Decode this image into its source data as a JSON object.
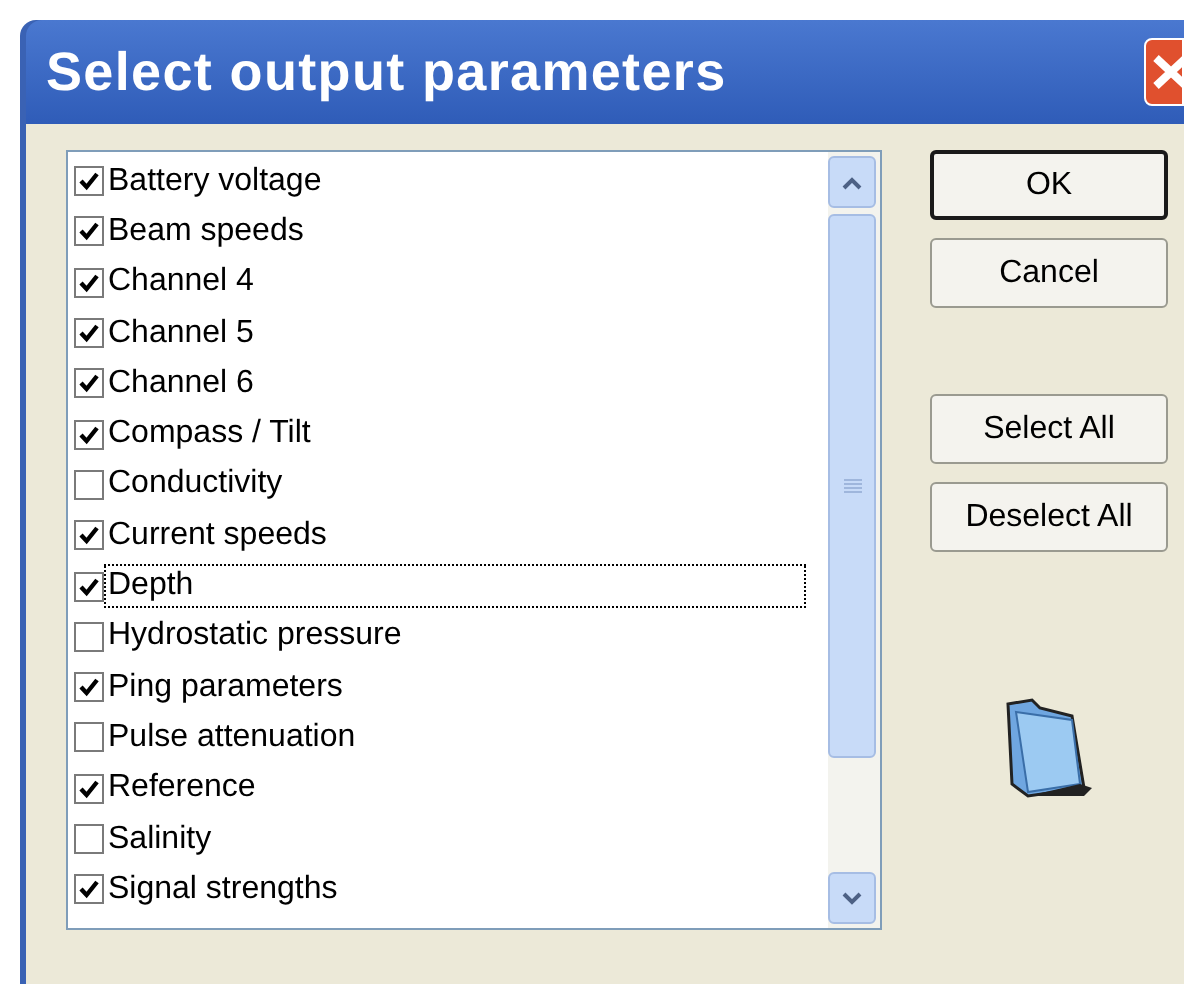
{
  "window": {
    "title": "Select output parameters"
  },
  "parameters": [
    {
      "label": "Battery voltage",
      "checked": true,
      "focused": false
    },
    {
      "label": "Beam speeds",
      "checked": true,
      "focused": false
    },
    {
      "label": "Channel 4",
      "checked": true,
      "focused": false
    },
    {
      "label": "Channel 5",
      "checked": true,
      "focused": false
    },
    {
      "label": "Channel 6",
      "checked": true,
      "focused": false
    },
    {
      "label": "Compass / Tilt",
      "checked": true,
      "focused": false
    },
    {
      "label": "Conductivity",
      "checked": false,
      "focused": false
    },
    {
      "label": "Current speeds",
      "checked": true,
      "focused": false
    },
    {
      "label": "Depth",
      "checked": true,
      "focused": true
    },
    {
      "label": "Hydrostatic pressure",
      "checked": false,
      "focused": false
    },
    {
      "label": "Ping parameters",
      "checked": true,
      "focused": false
    },
    {
      "label": "Pulse attenuation",
      "checked": false,
      "focused": false
    },
    {
      "label": "Reference",
      "checked": true,
      "focused": false
    },
    {
      "label": "Salinity",
      "checked": false,
      "focused": false
    },
    {
      "label": "Signal strengths",
      "checked": true,
      "focused": false
    }
  ],
  "buttons": [
    {
      "label": "OK",
      "kind": "default"
    },
    {
      "label": "Cancel",
      "kind": "normal"
    },
    {
      "label": "Select All",
      "kind": "gap"
    },
    {
      "label": "Deselect All",
      "kind": "normal"
    }
  ]
}
